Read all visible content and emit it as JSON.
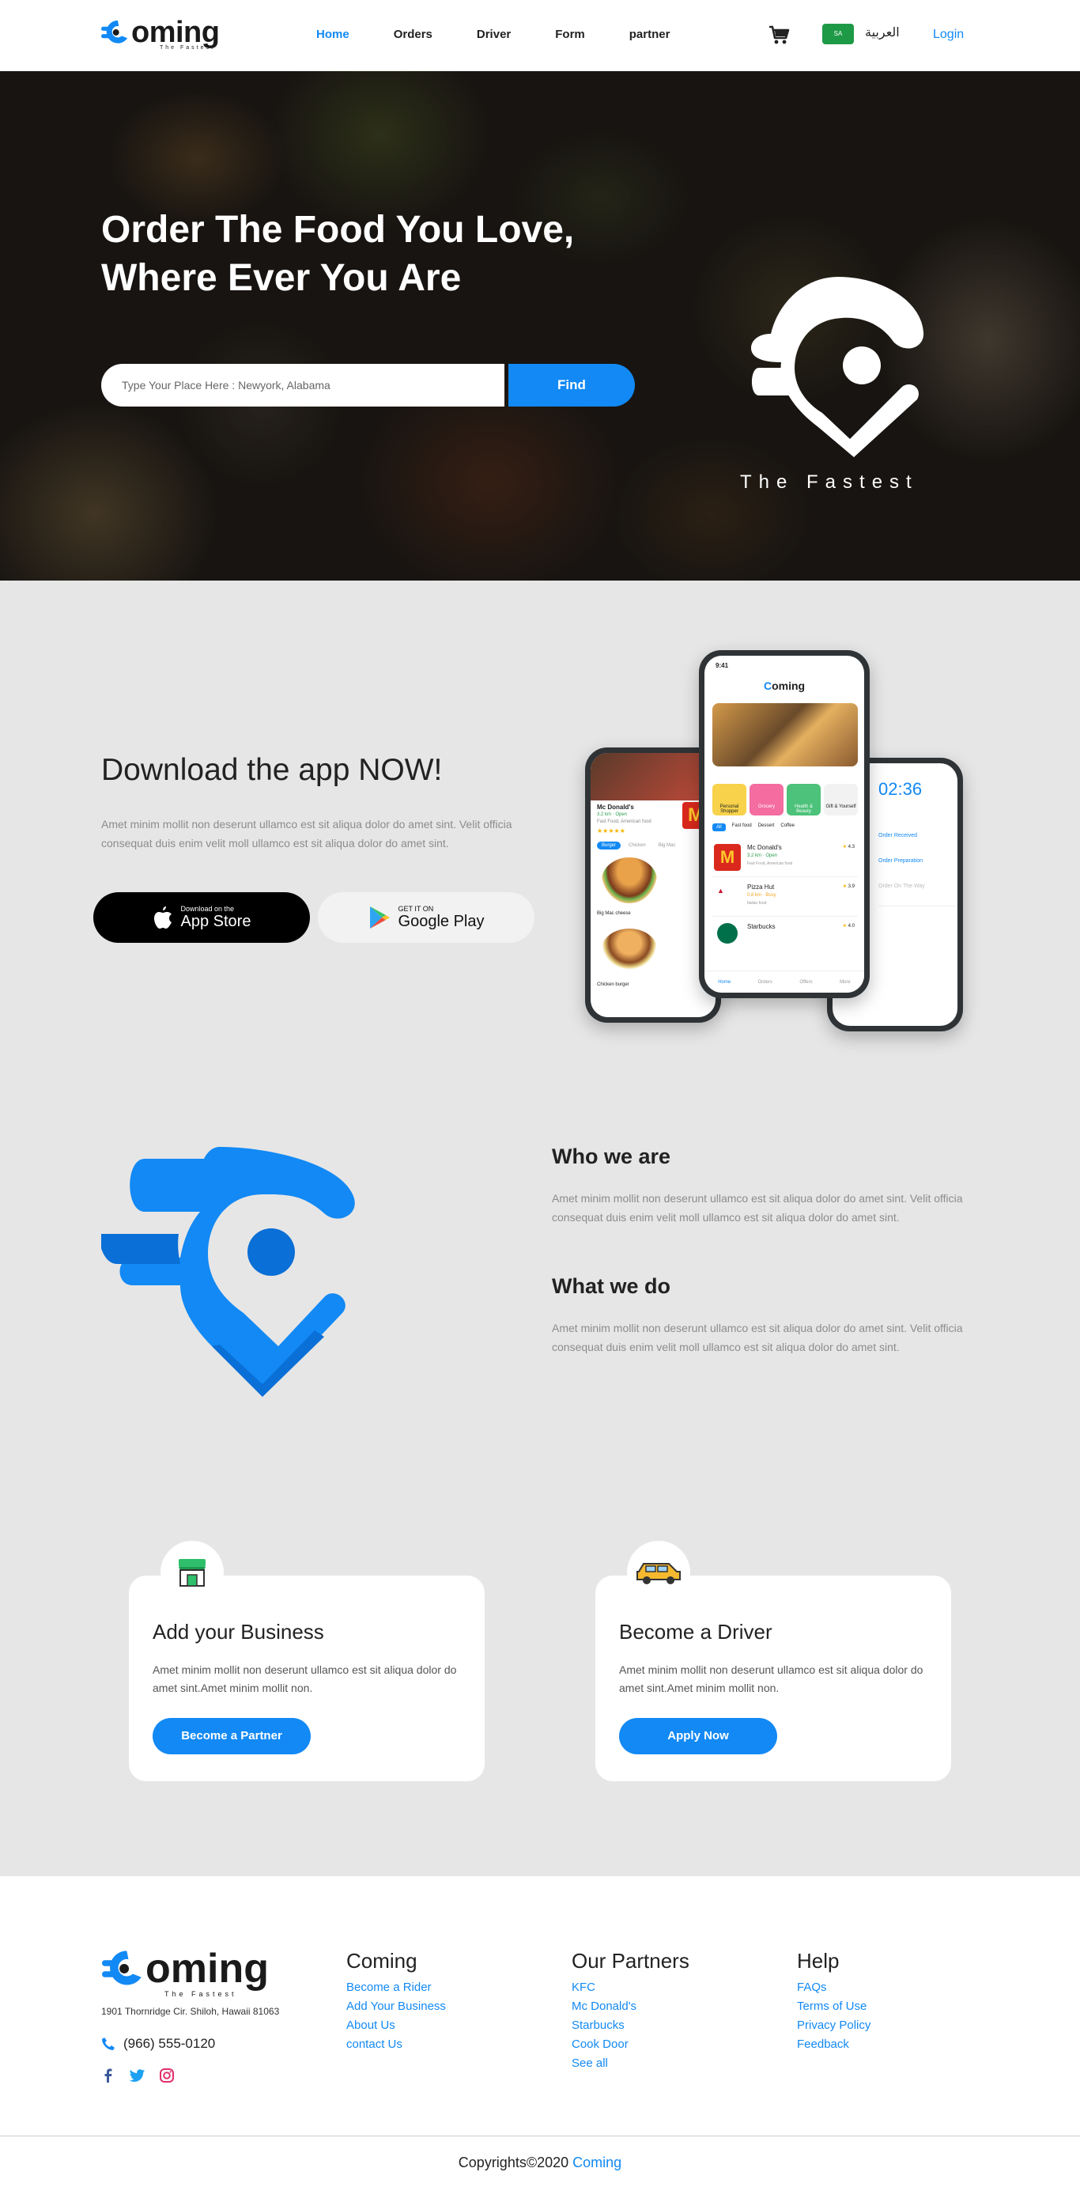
{
  "brand": {
    "name": "oming",
    "tagline": "The Fastest"
  },
  "nav": {
    "items": [
      {
        "label": "Home",
        "active": true
      },
      {
        "label": "Orders"
      },
      {
        "label": "Driver"
      },
      {
        "label": "Form"
      },
      {
        "label": "partner"
      }
    ],
    "flag_label": "SA",
    "language": "العربية",
    "login": "Login"
  },
  "hero": {
    "title": "Order The Food You Love, Where Ever You Are",
    "search_placeholder": "Type Your Place Here : Newyork, Alabama",
    "find_label": "Find",
    "logo_tagline": "The Fastest"
  },
  "download": {
    "title": "Download the app NOW!",
    "description": "Amet minim mollit non deserunt ullamco est sit aliqua dolor do amet sint. Velit officia consequat duis enim velit moll ullamco est sit aliqua dolor do amet sint.",
    "appstore": {
      "small": "Download on the",
      "big": "App Store"
    },
    "googleplay": {
      "small": "GET IT ON",
      "big": "Google Play"
    }
  },
  "phones": {
    "center": {
      "time": "9:41",
      "brand": "oming",
      "categories": [
        "Personal Shopper",
        "Grocery",
        "Health & Beauty",
        "Gift & Yourself"
      ],
      "filters": [
        "All",
        "Fast food",
        "Dessert",
        "Coffee"
      ],
      "restaurants": [
        {
          "name": "Mc Donald's",
          "meta": "3.2 km · Open",
          "sub": "Fast Food, American food",
          "rating": "4.3"
        },
        {
          "name": "Pizza Hut",
          "meta": "0.8 km · Busy",
          "sub": "Italian food",
          "rating": "3.9"
        },
        {
          "name": "Starbucks",
          "meta": "",
          "sub": "",
          "rating": "4.0"
        }
      ],
      "tabs": [
        "Home",
        "Orders",
        "Offers",
        "More"
      ]
    },
    "left": {
      "name": "Mc Donald's",
      "meta": "3.2 km · Open",
      "sub": "Fast Food, American food",
      "chips": [
        "Burger",
        "Chicken",
        "Big Mac"
      ],
      "items": [
        "Big Mac cheese",
        "Chicken burger"
      ]
    },
    "right": {
      "timer": "02:36",
      "steps": [
        "Order Received",
        "Order Preparation",
        "Order On The Way"
      ]
    }
  },
  "about": {
    "who_title": "Who we are",
    "who_text": "Amet minim mollit non deserunt ullamco est sit aliqua dolor do amet sint. Velit officia consequat duis enim velit moll ullamco est sit aliqua dolor do amet sint.",
    "what_title": "What we do",
    "what_text": "Amet minim mollit non deserunt ullamco est sit aliqua dolor do amet sint. Velit officia consequat duis enim velit moll ullamco est sit aliqua dolor do amet sint."
  },
  "cards": [
    {
      "title": "Add your Business",
      "text": "Amet minim mollit non deserunt ullamco est sit aliqua dolor do amet sint.Amet minim mollit non.",
      "button": "Become a Partner"
    },
    {
      "title": "Become a Driver",
      "text": "Amet minim mollit non deserunt ullamco est sit aliqua dolor do amet sint.Amet minim mollit non.",
      "button": "Apply Now"
    }
  ],
  "footer": {
    "address": "1901 Thornridge Cir. Shiloh, Hawaii 81063",
    "phone": "(966) 555-0120",
    "columns": [
      {
        "title": "Coming",
        "links": [
          "Become a Rider",
          "Add Your Business",
          "About Us",
          "contact Us"
        ]
      },
      {
        "title": "Our Partners",
        "links": [
          "KFC",
          "Mc Donald's",
          "Starbucks",
          "Cook Door",
          "See all"
        ]
      },
      {
        "title": "Help",
        "links": [
          "FAQs",
          "Terms of Use",
          "Privacy Policy",
          "Feedback"
        ]
      }
    ],
    "copyright_prefix": "Copyrights©2020",
    "copyright_brand": "Coming"
  },
  "colors": {
    "accent": "#1289f4",
    "accent_dark": "#0a6fd6",
    "background": "#e6e6e6"
  }
}
